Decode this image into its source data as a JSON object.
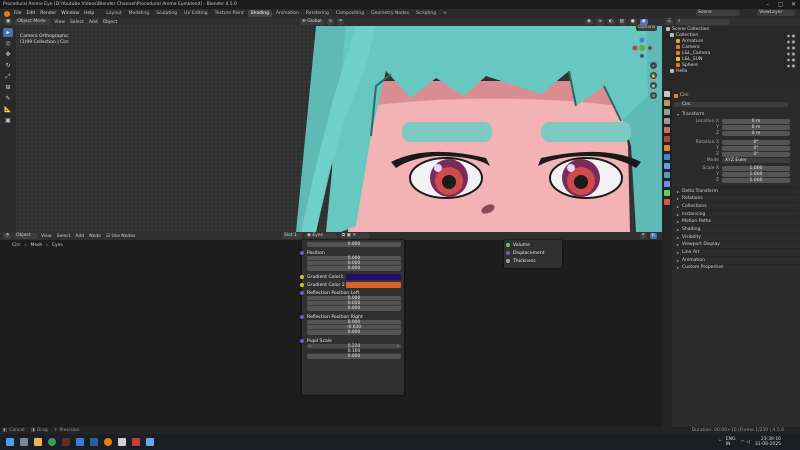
{
  "window": {
    "title": "Procedural Anime Eye [D:\\Youtube Videos\\Blender Channel\\Procedural Anime Eye\\blend] - Blender 4.5.0"
  },
  "menu": {
    "items": [
      "File",
      "Edit",
      "Render",
      "Window",
      "Help"
    ],
    "workspaces": [
      "Layout",
      "Modeling",
      "Sculpting",
      "UV Editing",
      "Texture Paint",
      "Shading",
      "Animation",
      "Rendering",
      "Compositing",
      "Geometry Nodes",
      "Scripting"
    ],
    "active_workspace": "Shading",
    "scene_label": "Scene",
    "viewlayer_label": "ViewLayer"
  },
  "viewport": {
    "mode": "Object Mode",
    "menus": [
      "View",
      "Select",
      "Add",
      "Object"
    ],
    "options_label": "Options",
    "camera_line1": "Camera Orthographic",
    "camera_line2": "(1)09 Collection | Circ"
  },
  "outliner": {
    "header": "Scene Collection",
    "items": [
      {
        "label": "Collection",
        "level": 0,
        "color": "#c7c7c7"
      },
      {
        "label": "Armature",
        "level": 1,
        "color": "#e5a12a"
      },
      {
        "label": "Camera",
        "level": 1,
        "color": "#e57a2a"
      },
      {
        "label": "L&L_Camera",
        "level": 1,
        "color": "#e57a2a"
      },
      {
        "label": "L&L_SUN",
        "level": 1,
        "color": "#e5c12a"
      },
      {
        "label": "Sphere",
        "level": 1,
        "color": "#e57a2a"
      },
      {
        "label": "Hello",
        "level": 0,
        "color": "#c7c7c7"
      }
    ]
  },
  "properties": {
    "object_name": "Circ",
    "object_field": "Circ",
    "transform_label": "Transform",
    "location": {
      "label": "Location X",
      "x": "0 m",
      "y": "0 m",
      "z": "0 m"
    },
    "rotation": {
      "label": "Rotation X",
      "x": "0°",
      "y": "0°",
      "z": "0°"
    },
    "mode": {
      "label": "Mode",
      "value": "XYZ Euler"
    },
    "scale": {
      "label": "Scale X",
      "x": "1.000",
      "y": "1.000",
      "z": "1.000"
    },
    "sections": [
      "Delta Transform",
      "Relations",
      "Collections",
      "Instancing",
      "Motion Paths",
      "Shading",
      "Visibility",
      "Viewport Display",
      "Line Art",
      "Animation",
      "Custom Properties"
    ]
  },
  "node_editor": {
    "mode": "Object",
    "menus": [
      "View",
      "Select",
      "Add",
      "Node"
    ],
    "use_nodes": "Use Nodes",
    "slot": "Slot 1",
    "material": "Eyes",
    "breadcrumb": [
      "Circ",
      "Mesh",
      "Eyes"
    ]
  },
  "group_node": {
    "top_value": "0.000",
    "position": {
      "label": "Position",
      "values": [
        "0.000",
        "0.000",
        "0.000"
      ]
    },
    "gradient1": {
      "label": "Gradient Color1",
      "color": "#2a0a6b"
    },
    "gradient2": {
      "label": "Gradient Color 2",
      "color": "#d8622a"
    },
    "refl_left": {
      "label": "Reflection Position Left",
      "values": [
        "0.000",
        "0.050",
        "0.000"
      ]
    },
    "refl_right": {
      "label": "Reflection Position Right",
      "values": [
        "0.000",
        "-0.030",
        "0.000"
      ]
    },
    "pupil": {
      "label": "Pupil Scale",
      "values": [
        "0.220",
        "0.160",
        "0.000"
      ]
    }
  },
  "output_node": {
    "sockets": [
      "Volume",
      "Displacement",
      "Thickness"
    ]
  },
  "statusbar": {
    "left": [
      "Cancel",
      "Drag",
      "Precision"
    ],
    "right": "Duration: 00:00+10 (Frame 1/250 | 4.5.0"
  },
  "taskbar": {
    "lang": "ENG",
    "region": "IN",
    "time": "23:39:16",
    "date": "31-08-2025"
  }
}
